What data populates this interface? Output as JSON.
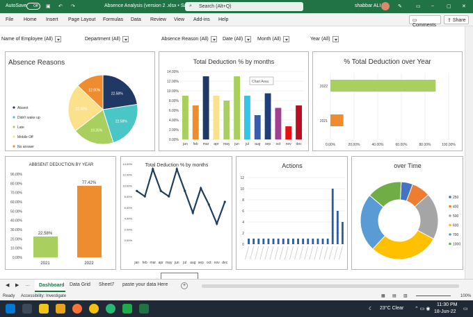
{
  "titlebar": {
    "autosave": "AutoSave",
    "autosave_state": "Off",
    "title": "Absence Analysis (version 2 .xlsx • Saved",
    "search": "Search (Alt+Q)",
    "user": "shabbar ALI"
  },
  "ribbon": {
    "menus": [
      "File",
      "Home",
      "Insert",
      "Page Layout",
      "Formulas",
      "Data",
      "Review",
      "View",
      "Add-ins",
      "Help"
    ],
    "comments": "Comments",
    "share": "Share"
  },
  "slicers": [
    "Name of Employee  (All)",
    "Department   (All)",
    "Absence Reason  (All)",
    "Date  (All)",
    "Month  (All)",
    "Year  (All)"
  ],
  "tooltip": "Chart Area",
  "charts": [
    {
      "title": "Absence Reasons",
      "type": "pie",
      "categories": [
        "Absent",
        "Didn't wake up",
        "Late",
        "Mobile Off",
        "No answer"
      ],
      "labels": [
        "22.58%",
        "22.58%",
        "19.35%",
        "22.58%",
        "12.90%"
      ],
      "values": [
        22.58,
        22.58,
        19.35,
        22.58,
        12.9
      ],
      "colors": [
        "#203864",
        "#4bc6c6",
        "#a9d05f",
        "#fbe18b",
        "#ed8d2f"
      ]
    },
    {
      "title": "Total Deduction % by months",
      "type": "bar",
      "categories": [
        "jan",
        "feb",
        "mar",
        "apr",
        "may",
        "jun",
        "jul",
        "aug",
        "sep",
        "oct",
        "nov",
        "dec"
      ],
      "values": [
        9,
        7,
        13,
        9,
        8,
        13,
        9,
        5,
        9.5,
        6.5,
        2.7,
        7
      ],
      "colors": [
        "#a9d05f",
        "#ed8d2f",
        "#203864",
        "#fbe18b",
        "#a9d05f",
        "#a9d05f",
        "#34c6e8",
        "#3a5ba8",
        "#1f3e7a",
        "#a04090",
        "#e81010",
        "#b81020"
      ],
      "ylim": [
        0,
        14
      ],
      "yticks": [
        "0.00%",
        "2.00%",
        "4.00%",
        "6.00%",
        "8.00%",
        "10.00%",
        "12.00%",
        "14.00%"
      ]
    },
    {
      "title": "% Total Deduction over Year",
      "type": "hbar",
      "categories": [
        "2021",
        "2022"
      ],
      "values": [
        11,
        89
      ],
      "colors": [
        "#ed8d2f",
        "#a9d05f"
      ],
      "xticks": [
        "0.00%",
        "20.00%",
        "40.00%",
        "60.00%",
        "80.00%",
        "100.00%"
      ]
    },
    {
      "title": "ABBSENT DEDUCTION BY YEAR",
      "type": "bar",
      "categories": [
        "2021",
        "2022"
      ],
      "values": [
        22.58,
        77.42
      ],
      "labels": [
        "22.58%",
        "77.42%"
      ],
      "colors": [
        "#a9d05f",
        "#ed8d2f"
      ],
      "yticks": [
        "0.00%",
        "10.00%",
        "20.00%",
        "30.00%",
        "40.00%",
        "50.00%",
        "60.00%",
        "70.00%",
        "80.00%",
        "90.00%"
      ]
    },
    {
      "title": "Total Deduction % by months",
      "type": "line",
      "categories": [
        "jan",
        "feb",
        "mar",
        "apr",
        "may",
        "jun",
        "jul",
        "aug",
        "sep",
        "oct",
        "nov",
        "dec"
      ],
      "values": [
        9,
        8,
        13,
        9,
        8,
        13,
        9,
        5,
        9.5,
        6.5,
        3,
        7
      ],
      "yticks": [
        "0.00%",
        "2.00%",
        "4.00%",
        "6.00%",
        "8.00%",
        "10.00%",
        "12.00%",
        "14.00%"
      ]
    },
    {
      "title": "Actions",
      "type": "bar",
      "values": [
        1,
        1,
        1,
        1,
        1,
        1,
        1,
        1,
        1,
        1,
        1,
        1,
        1,
        1,
        1,
        1,
        1,
        10,
        6,
        4
      ],
      "yticks": [
        "0",
        "2",
        "4",
        "6",
        "8",
        "10",
        "12"
      ]
    },
    {
      "title": "over Time",
      "type": "donut",
      "categories": [
        "250",
        "400",
        "500",
        "600",
        "700",
        "1000"
      ],
      "values": [
        5,
        8,
        20,
        30,
        25,
        15
      ],
      "colors": [
        "#4472c4",
        "#ed7d31",
        "#a5a5a5",
        "#ffc000",
        "#5b9bd5",
        "#70ad47"
      ]
    }
  ],
  "tabs": [
    "Dashboard",
    "Data Grid",
    "Sheet7",
    "paste your data Here"
  ],
  "status": {
    "ready": "Ready",
    "accessibility": "Accessibility: Investigate",
    "zoom": "100%"
  },
  "taskbar": {
    "weather": "23°C  Clear",
    "time": "11:30 PM",
    "date": "18-Jun-22"
  }
}
